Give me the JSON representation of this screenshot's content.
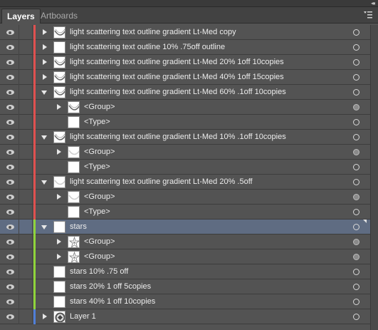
{
  "window": {
    "collapse_glyph": "◂◂"
  },
  "tabs": [
    {
      "label": "Layers"
    },
    {
      "label": "Artboards"
    }
  ],
  "panel_menu_icon": "panel-menu-icon",
  "colors": {
    "red_layer": "#e0504f",
    "green_layer": "#8fd43a",
    "blue_layer": "#4f7fd8",
    "selection": "#5f6c82"
  },
  "rows": [
    {
      "label": "light scattering text outline gradient Lt-Med copy",
      "depth": 0,
      "expand": "right",
      "thumb": "arc",
      "color": "red",
      "target": "hollow"
    },
    {
      "label": "light scattering text outline 10% .75off outline",
      "depth": 0,
      "expand": "right",
      "thumb": "blank",
      "color": "red",
      "target": "hollow"
    },
    {
      "label": "light scattering text outline gradient Lt-Med 20% 1off 10copies",
      "depth": 0,
      "expand": "right",
      "thumb": "arc",
      "color": "red",
      "target": "hollow"
    },
    {
      "label": "light scattering text outline gradient Lt-Med 40% 1off 15copies",
      "depth": 0,
      "expand": "right",
      "thumb": "arc",
      "color": "red",
      "target": "hollow"
    },
    {
      "label": "light scattering text outline gradient Lt-Med 60% .1off 10copies",
      "depth": 0,
      "expand": "down",
      "thumb": "arc",
      "color": "red",
      "target": "hollow"
    },
    {
      "label": "<Group>",
      "depth": 1,
      "expand": "right",
      "thumb": "arc",
      "color": "red",
      "target": "filled"
    },
    {
      "label": "<Type>",
      "depth": 1,
      "expand": "none",
      "thumb": "blank",
      "color": "red",
      "target": "hollow"
    },
    {
      "label": "light scattering text outline gradient Lt-Med 10% .1off 10copies",
      "depth": 0,
      "expand": "down",
      "thumb": "arc",
      "color": "red",
      "target": "hollow"
    },
    {
      "label": "<Group>",
      "depth": 1,
      "expand": "right",
      "thumb": "arc-light",
      "color": "red",
      "target": "filled"
    },
    {
      "label": "<Type>",
      "depth": 1,
      "expand": "none",
      "thumb": "blank",
      "color": "red",
      "target": "hollow"
    },
    {
      "label": "light scattering text outline gradient Lt-Med 20% .5off",
      "depth": 0,
      "expand": "down",
      "thumb": "arc-light",
      "color": "red",
      "target": "hollow"
    },
    {
      "label": "<Group>",
      "depth": 1,
      "expand": "right",
      "thumb": "arc-light",
      "color": "red",
      "target": "filled"
    },
    {
      "label": "<Type>",
      "depth": 1,
      "expand": "none",
      "thumb": "blank",
      "color": "red",
      "target": "hollow"
    },
    {
      "label": "stars",
      "depth": 0,
      "expand": "down",
      "thumb": "blank",
      "color": "green",
      "target": "hollow",
      "selected": true
    },
    {
      "label": "<Group>",
      "depth": 1,
      "expand": "right",
      "thumb": "star",
      "color": "green",
      "target": "filled"
    },
    {
      "label": "<Group>",
      "depth": 1,
      "expand": "right",
      "thumb": "star",
      "color": "green",
      "target": "filled"
    },
    {
      "label": "stars 10% .75 off",
      "depth": 0,
      "expand": "none",
      "thumb": "blank",
      "color": "green",
      "target": "hollow"
    },
    {
      "label": "stars 20% 1 off 5copies",
      "depth": 0,
      "expand": "none",
      "thumb": "blank",
      "color": "green",
      "target": "hollow"
    },
    {
      "label": "stars 40% 1 off 10copies",
      "depth": 0,
      "expand": "none",
      "thumb": "blank",
      "color": "green",
      "target": "hollow"
    },
    {
      "label": "Layer 1",
      "depth": 0,
      "expand": "right",
      "thumb": "badge",
      "color": "blue",
      "target": "hollow"
    }
  ]
}
